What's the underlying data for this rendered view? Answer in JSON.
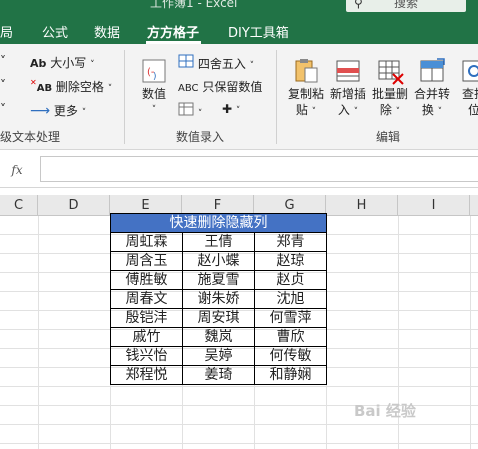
{
  "window": {
    "title": "工作簿1 - Excel",
    "search_placeholder": "搜索"
  },
  "tabs": [
    {
      "label": "局"
    },
    {
      "label": "公式"
    },
    {
      "label": "数据"
    },
    {
      "label": "方方格子",
      "active": true
    },
    {
      "label": "DIY工具箱"
    }
  ],
  "ribbon": {
    "text_group": {
      "case_label": "大小写",
      "remove_space_label": "删除空格",
      "more_label": "更多",
      "group_label": "级文本处理"
    },
    "number_group": {
      "number_label": "数值",
      "round_label": "四舍五入",
      "keep_number_label": "只保留数值",
      "group_label": "数值录入"
    },
    "edit_group": {
      "copy_paste_label": "复制粘\n贴",
      "insert_label": "新增插\n入",
      "batch_delete_label": "批量删\n除",
      "merge_label": "合并转\n换",
      "find_label": "查找\n位",
      "group_label": "编辑"
    }
  },
  "formula_bar": {
    "fx_label": "fx",
    "value": ""
  },
  "columns": [
    "C",
    "D",
    "E",
    "F",
    "G",
    "H",
    "I"
  ],
  "table": {
    "header": "快速删除隐藏列",
    "rows": [
      [
        "周虹霖",
        "王倩",
        "郑青"
      ],
      [
        "周含玉",
        "赵小蝶",
        "赵琼"
      ],
      [
        "傅胜敏",
        "施夏雪",
        "赵贞"
      ],
      [
        "周春文",
        "谢朱娇",
        "沈旭"
      ],
      [
        "殷铠沣",
        "周安琪",
        "何雪萍"
      ],
      [
        "戚竹",
        "魏岚",
        "曹欣"
      ],
      [
        "钱兴怡",
        "吴婷",
        "何传敏"
      ],
      [
        "郑程悦",
        "姜琦",
        "和静娴"
      ]
    ]
  },
  "watermark": "Bai 经验",
  "colors": {
    "excel_green": "#217346",
    "table_header_blue": "#4472c4"
  }
}
